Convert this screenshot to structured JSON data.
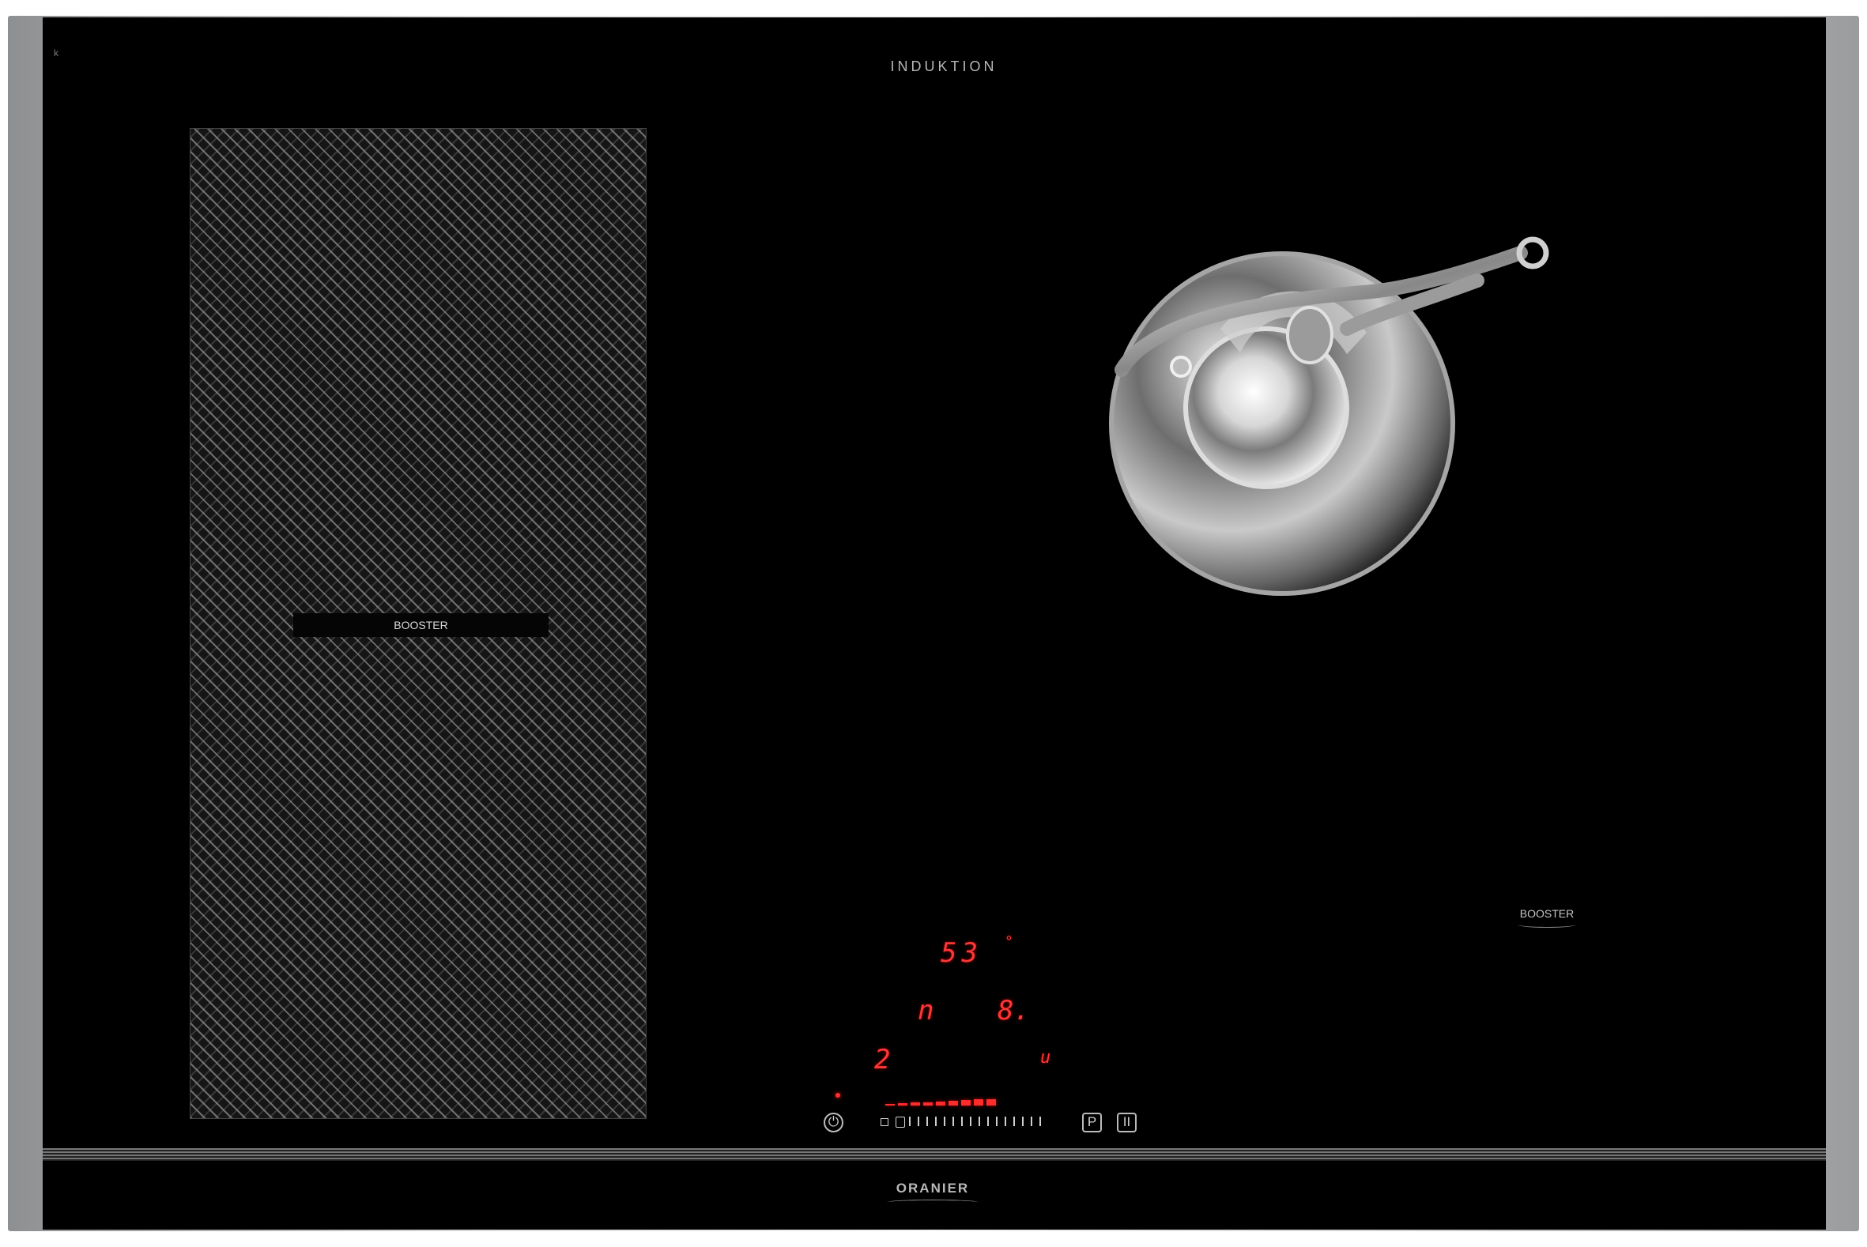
{
  "top_label": "INDUKTION",
  "corner_mark": "k",
  "zones": {
    "left_booster": "BOOSTER",
    "right_booster": "BOOSTER"
  },
  "controls": {
    "temperature": "53",
    "temperature_unit_marker": "°",
    "mode": "n",
    "power_level": "8.",
    "step": "2",
    "timer_marker": "u",
    "power_icon": "power-icon",
    "program_button": "P",
    "pause_button": "II",
    "level_fraction": 0.75
  },
  "brand": "ORANIER",
  "colors": {
    "glass": "#000000",
    "frame": "#dcdedf",
    "display": "#ff3434"
  }
}
